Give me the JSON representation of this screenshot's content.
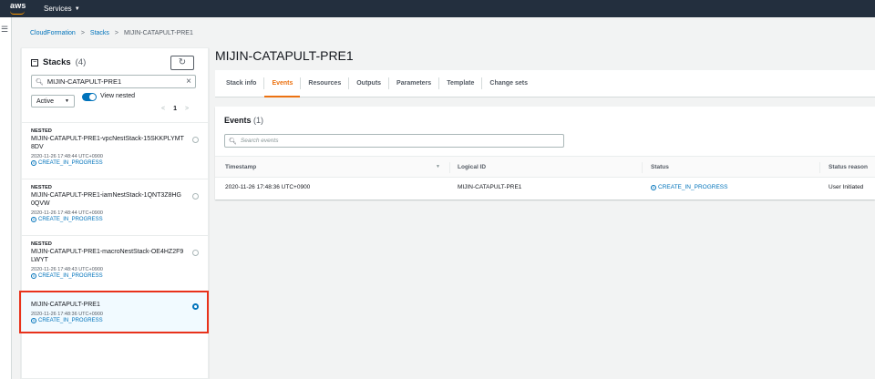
{
  "topbar": {
    "logo_text": "aws",
    "services_label": "Services"
  },
  "breadcrumb": {
    "items": [
      "CloudFormation",
      "Stacks",
      "MIJIN-CATAPULT-PRE1"
    ]
  },
  "stacks_panel": {
    "title": "Stacks",
    "count": "(4)",
    "search_value": "MIJIN-CATAPULT-PRE1",
    "filter_selected": "Active",
    "toggle_label": "View nested",
    "toggle_on": true,
    "page": "1",
    "items": [
      {
        "nested_label": "NESTED",
        "name": "MIJIN-CATAPULT-PRE1-vpcNestStack-15SKKPLYMT8DV",
        "timestamp": "2020-11-26 17:48:44 UTC+0900",
        "status": "CREATE_IN_PROGRESS",
        "selected": false
      },
      {
        "nested_label": "NESTED",
        "name": "MIJIN-CATAPULT-PRE1-iamNestStack-1QNT3Z8HG0QVW",
        "timestamp": "2020-11-26 17:48:44 UTC+0900",
        "status": "CREATE_IN_PROGRESS",
        "selected": false
      },
      {
        "nested_label": "NESTED",
        "name": "MIJIN-CATAPULT-PRE1-macroNestStack-OE4HZ2F9LWYT",
        "timestamp": "2020-11-26 17:48:43 UTC+0900",
        "status": "CREATE_IN_PROGRESS",
        "selected": false
      },
      {
        "nested_label": "",
        "name": "MIJIN-CATAPULT-PRE1",
        "timestamp": "2020-11-26 17:48:36 UTC+0900",
        "status": "CREATE_IN_PROGRESS",
        "selected": true
      }
    ]
  },
  "main": {
    "title": "MIJIN-CATAPULT-PRE1",
    "tabs": [
      {
        "label": "Stack info",
        "active": false
      },
      {
        "label": "Events",
        "active": true
      },
      {
        "label": "Resources",
        "active": false
      },
      {
        "label": "Outputs",
        "active": false
      },
      {
        "label": "Parameters",
        "active": false
      },
      {
        "label": "Template",
        "active": false
      },
      {
        "label": "Change sets",
        "active": false
      }
    ],
    "events": {
      "title": "Events",
      "count": "(1)",
      "search_placeholder": "Search events",
      "columns": [
        "Timestamp",
        "Logical ID",
        "Status",
        "Status reason"
      ],
      "rows": [
        {
          "timestamp": "2020-11-26 17:48:36 UTC+0900",
          "logical_id": "MIJIN-CATAPULT-PRE1",
          "status": "CREATE_IN_PROGRESS",
          "reason": "User Initiated"
        }
      ]
    }
  },
  "colors": {
    "nav_bg": "#232f3e",
    "link": "#0073bb",
    "active_tab": "#ec7211",
    "highlight": "#e8321b"
  }
}
